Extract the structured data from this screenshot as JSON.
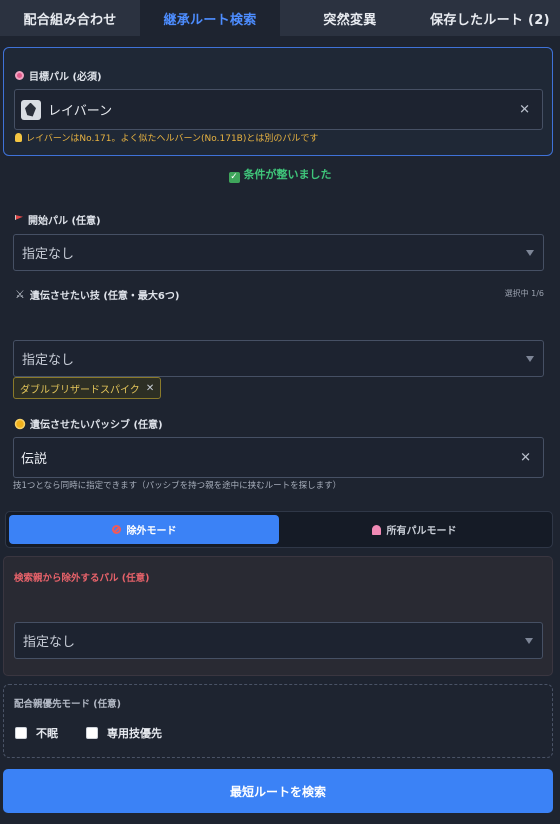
{
  "tabs": [
    {
      "label": "配合組み合わせ",
      "active": false
    },
    {
      "label": "継承ルート検索",
      "active": true
    },
    {
      "label": "突然変異",
      "active": false
    },
    {
      "label": "保存したルート (2)",
      "active": false
    }
  ],
  "target": {
    "label": "目標パル (必須)",
    "value": "レイバーン",
    "note": "レイバーンはNo.171。よく似たヘルバーン(No.171B)とは別のパルです"
  },
  "status_ok": "条件が整いました",
  "start_pal": {
    "label": "開始パル (任意)",
    "placeholder": "指定なし"
  },
  "skills": {
    "label": "遺伝させたい技 (任意・最大6つ)",
    "count": "選択中 1/6",
    "placeholder": "指定なし",
    "selected": [
      "ダブルブリザードスパイク"
    ]
  },
  "passive": {
    "label": "遺伝させたいパッシブ (任意)",
    "value": "伝説",
    "hint": "技1つとなら同時に指定できます（パッシブを持つ親を途中に挟むルートを探します）"
  },
  "modes": [
    {
      "label": "除外モード",
      "active": true
    },
    {
      "label": "所有パルモード",
      "active": false
    }
  ],
  "exclude": {
    "label": "検索親から除外するパル (任意)",
    "placeholder": "指定なし"
  },
  "priority": {
    "label": "配合親優先モード (任意)",
    "options": [
      {
        "label": "不眠",
        "checked": false
      },
      {
        "label": "専用技優先",
        "checked": false
      }
    ]
  },
  "search_button": "最短ルートを検索",
  "colors": {
    "accent": "#3b82f6",
    "ok": "#3fc57a",
    "warn": "#e8b341",
    "danger": "#e7626a"
  }
}
